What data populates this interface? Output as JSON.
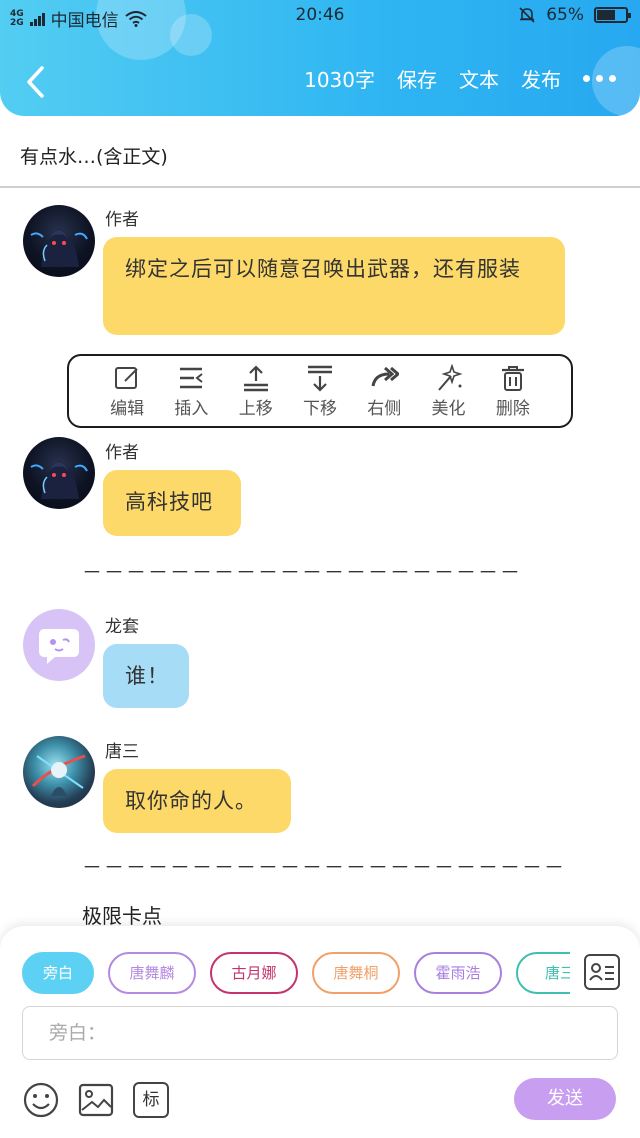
{
  "status_bar": {
    "network_type": "4G",
    "network_type_2": "2G",
    "carrier": "中国电信",
    "time": "20:46",
    "battery": "65%",
    "battery_level": 0.65
  },
  "toolbar": {
    "word_count": "1030字",
    "save_label": "保存",
    "text_label": "文本",
    "publish_label": "发布"
  },
  "title": "有点水…(含正文)",
  "messages": [
    {
      "sender": "作者",
      "text": "绑定之后可以随意召唤出武器，还有服装"
    },
    {
      "sender": "作者",
      "text": "高科技吧"
    },
    {
      "sender": "龙套",
      "text": "谁！"
    },
    {
      "sender": "唐三",
      "text": "取你命的人。"
    }
  ],
  "actions": [
    {
      "label": "编辑",
      "icon": "edit-icon"
    },
    {
      "label": "插入",
      "icon": "insert-icon"
    },
    {
      "label": "上移",
      "icon": "move-up-icon"
    },
    {
      "label": "下移",
      "icon": "move-down-icon"
    },
    {
      "label": "右侧",
      "icon": "redo-icon"
    },
    {
      "label": "美化",
      "icon": "sparkle-icon"
    },
    {
      "label": "删除",
      "icon": "trash-icon"
    }
  ],
  "divider_1": "－－－－－－－－－－－－－－－－－－－－",
  "divider_2": "－－－－－－－－－－－－－－－－－－－－－－",
  "section_title": "极限卡点",
  "characters": [
    {
      "name": "旁白",
      "color": "#5dd1f3"
    },
    {
      "name": "唐舞麟",
      "color": "#b48ae0"
    },
    {
      "name": "古月娜",
      "color": "#c4336e"
    },
    {
      "name": "唐舞桐",
      "color": "#f2a06a"
    },
    {
      "name": "霍雨浩",
      "color": "#a77fe0"
    },
    {
      "name": "唐三",
      "color": "#3fbfb0"
    }
  ],
  "input": {
    "placeholder": "旁白："
  },
  "send_label": "发送",
  "mark_label": "标",
  "colors": {
    "header_start": "#53cdf2",
    "header_end": "#27a8f0",
    "bubble_yellow": "#fdd96a",
    "bubble_blue": "#a6dcf6",
    "send": "#c89ef0"
  }
}
